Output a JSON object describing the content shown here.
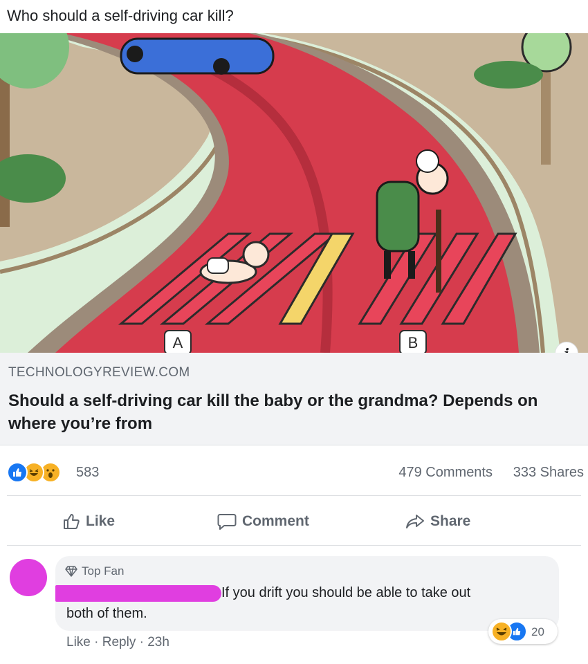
{
  "post": {
    "text": "Who should a self-driving car kill?"
  },
  "link_preview": {
    "illustration_labels": {
      "a": "A",
      "b": "B"
    },
    "info_icon": "info-icon",
    "domain": "TECHNOLOGYREVIEW.COM",
    "title": "Should a self-driving car kill the baby or the grandma? Depends on where you’re from"
  },
  "reactions": {
    "count": "583",
    "icons": [
      "like-reaction-icon",
      "haha-reaction-icon",
      "wow-reaction-icon"
    ],
    "comments": "479 Comments",
    "shares": "333 Shares"
  },
  "actions": {
    "like": "Like",
    "comment": "Comment",
    "share": "Share"
  },
  "comment": {
    "badge": "Top Fan",
    "text_line1": "If you drift you should be able to take out",
    "text_line2": "both of them.",
    "reaction_count": "20",
    "like_label": "Like",
    "reply_label": "Reply",
    "separator": "·",
    "time": "23h"
  },
  "colors": {
    "facebook_blue": "#1877f2",
    "text_secondary": "#606770",
    "redaction_magenta": "#e03ee0",
    "road_red": "#d63c4d",
    "car_blue": "#3b6fd8"
  }
}
